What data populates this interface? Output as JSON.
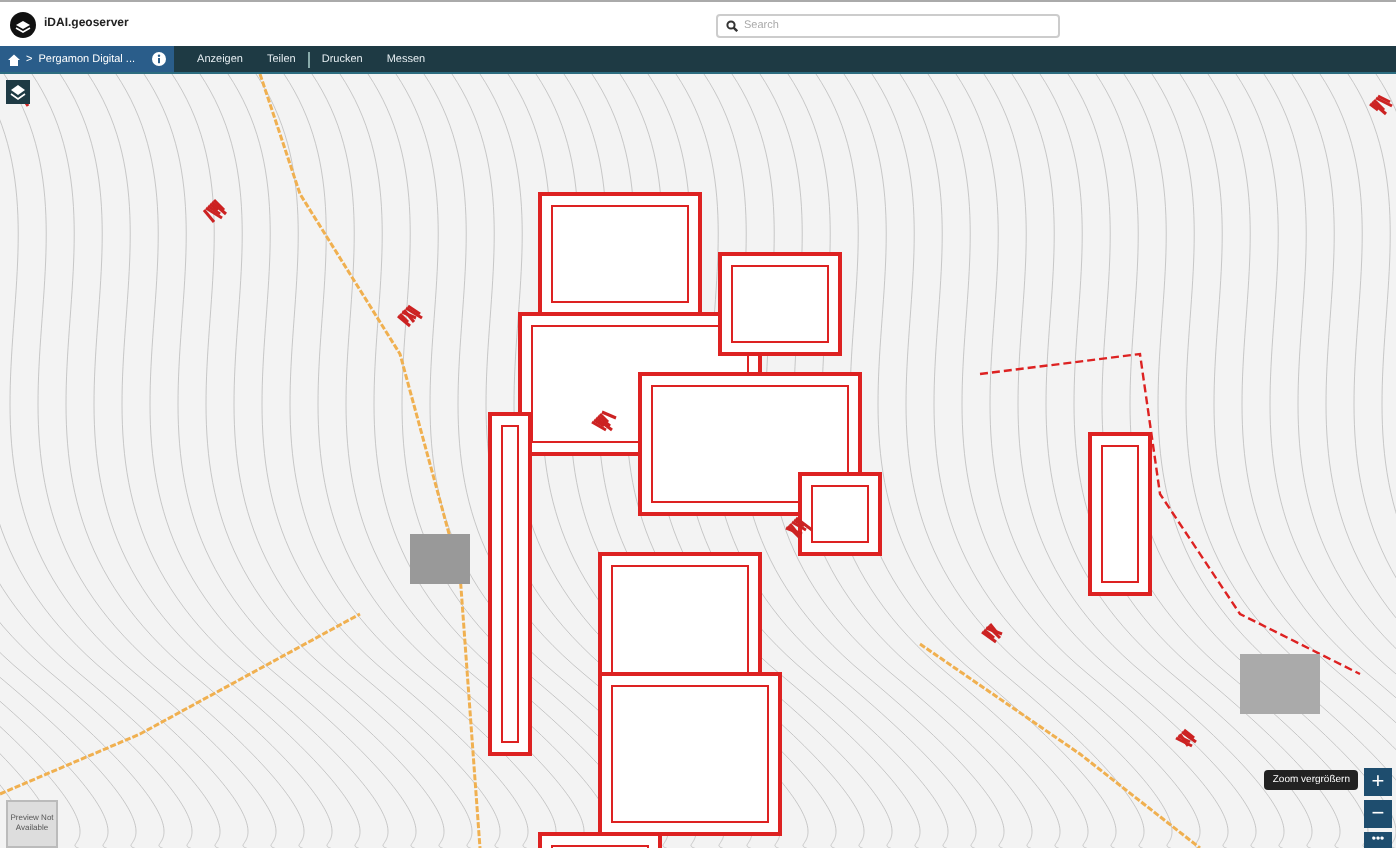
{
  "header": {
    "logo_text": "iDAI.geoserver",
    "search": {
      "placeholder": "Search"
    }
  },
  "navbar": {
    "breadcrumb": {
      "separator": ">",
      "label": "Pergamon Digital ..."
    },
    "menu": [
      {
        "label": "Anzeigen",
        "divider_before": false
      },
      {
        "label": "Teilen",
        "divider_before": false
      },
      {
        "label": "Drucken",
        "divider_before": true
      },
      {
        "label": "Messen",
        "divider_before": false
      }
    ]
  },
  "map": {
    "preview": {
      "text": "Preview Not Available"
    },
    "zoom_in": {
      "label": "+",
      "tooltip": "Zoom vergrößern"
    },
    "zoom_out": {
      "label": "−"
    },
    "more": {
      "label": "•••"
    }
  }
}
